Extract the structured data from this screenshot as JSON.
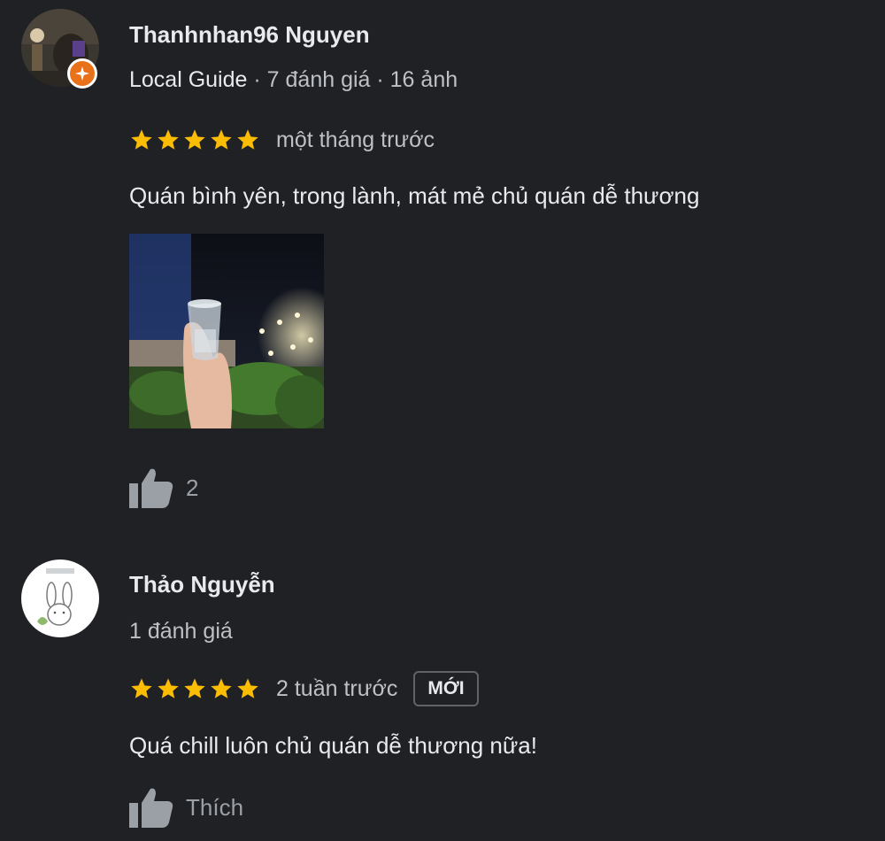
{
  "reviews": [
    {
      "name": "Thanhnhan96 Nguyen",
      "guide_label": "Local Guide",
      "meta_separator": " · ",
      "review_count": "7 đánh giá",
      "photo_count": "16 ảnh",
      "rating": 5,
      "time_ago": "một tháng trước",
      "text": "Quán bình yên, trong lành, mát mẻ chủ quán dễ thương",
      "likes": "2",
      "icons": {
        "badge": "local-guide-badge-icon",
        "like": "thumbs-up-icon",
        "star": "star-icon"
      }
    },
    {
      "name": "Thảo Nguyễn",
      "review_count": "1 đánh giá",
      "rating": 5,
      "time_ago": "2 tuần trước",
      "new_badge": "MỚI",
      "text": "Quá chill luôn chủ quán dễ thương nữa!",
      "like_label": "Thích",
      "icons": {
        "like": "thumbs-up-icon",
        "star": "star-icon"
      }
    }
  ],
  "colors": {
    "background": "#202124",
    "star": "#fbbc04",
    "badge": "#e8711a",
    "text_primary": "#e8eaed",
    "text_secondary": "#bdc1c6",
    "like_icon": "#9aa0a6"
  }
}
